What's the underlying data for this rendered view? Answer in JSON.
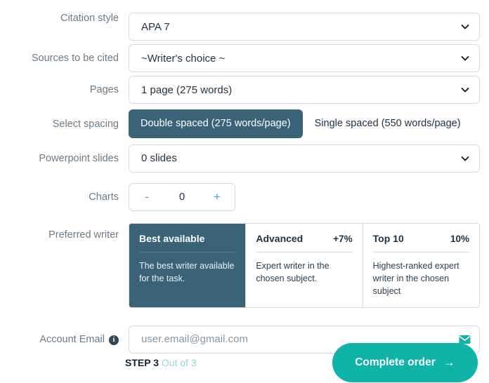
{
  "rows": {
    "citation": {
      "label": "Citation style",
      "value": "APA 7"
    },
    "sources": {
      "label": "Sources to be cited",
      "value": "~Writer's choice ~"
    },
    "pages": {
      "label": "Pages",
      "value": "1 page (275 words)"
    },
    "spacing": {
      "label": "Select spacing",
      "options": [
        {
          "label": "Double spaced (275 words/page)",
          "selected": true
        },
        {
          "label": "Single spaced (550 words/page)",
          "selected": false
        }
      ]
    },
    "slides": {
      "label": "Powerpoint slides",
      "value": "0 slides"
    },
    "charts": {
      "label": "Charts",
      "value": "0",
      "decrement": "-",
      "increment": "+"
    },
    "writer": {
      "label": "Preferred writer",
      "cards": [
        {
          "title": "Best available",
          "price": "",
          "desc": "The best writer available for the task.",
          "selected": true
        },
        {
          "title": "Advanced",
          "price": "+7%",
          "desc": "Expert writer in the chosen subject.",
          "selected": false
        },
        {
          "title": "Top 10",
          "price": "10%",
          "desc": "Highest-ranked expert writer in the chosen subject",
          "selected": false
        }
      ]
    },
    "email": {
      "label": "Account Email",
      "info_icon": "info-icon",
      "value": "",
      "placeholder": "user.email@gmail.com",
      "field_icon": "envelope-icon"
    }
  },
  "footer": {
    "step_strong": "STEP 3",
    "step_light": "Out of 3",
    "cta_label": "Complete order",
    "cta_icon": "arrow-right-icon"
  },
  "colors": {
    "accent_teal": "#0fb3a8",
    "selected_navy": "#3a6378",
    "stepper_blue": "#3fa0e3",
    "step_light": "#8fd9d4",
    "border": "#d7d9e6"
  }
}
